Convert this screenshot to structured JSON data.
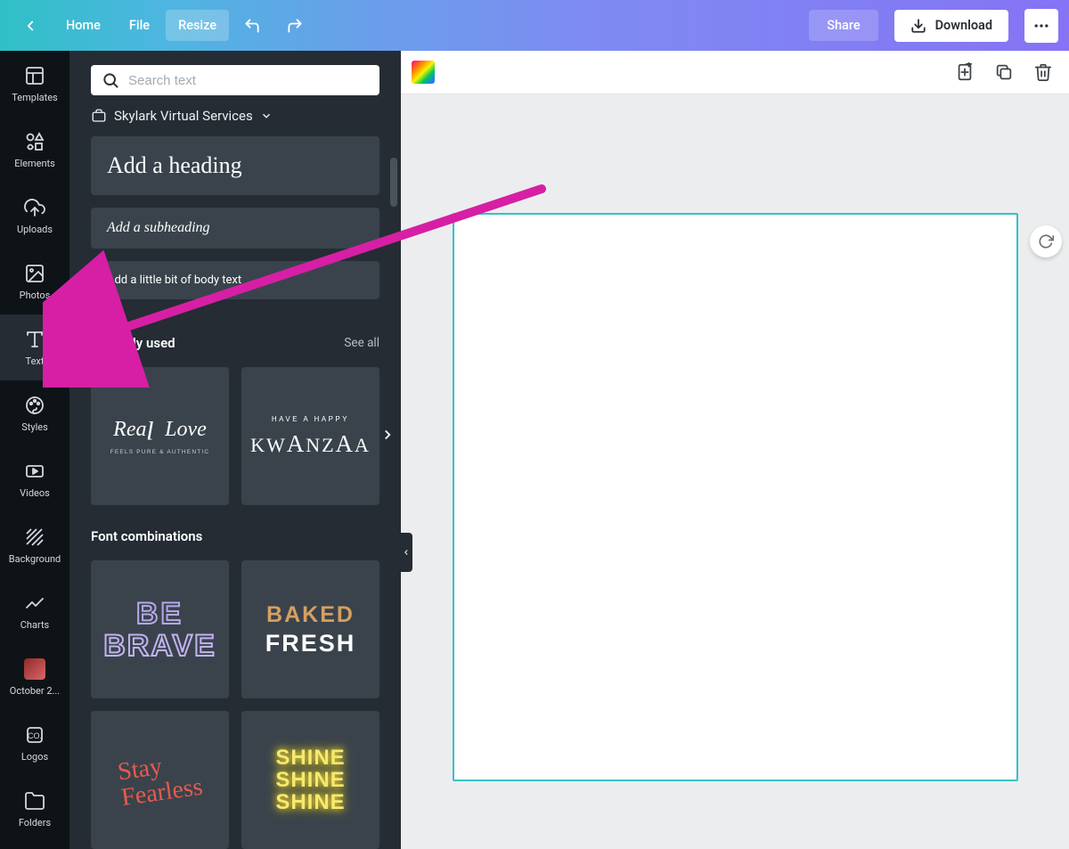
{
  "header": {
    "home": "Home",
    "file": "File",
    "resize": "Resize",
    "share": "Share",
    "download": "Download"
  },
  "sidebar": {
    "items": [
      {
        "label": "Templates"
      },
      {
        "label": "Elements"
      },
      {
        "label": "Uploads"
      },
      {
        "label": "Photos"
      },
      {
        "label": "Text"
      },
      {
        "label": "Styles"
      },
      {
        "label": "Videos"
      },
      {
        "label": "Background"
      },
      {
        "label": "Charts"
      },
      {
        "label": "October 2..."
      },
      {
        "label": "Logos"
      },
      {
        "label": "Folders"
      }
    ]
  },
  "panel": {
    "search_placeholder": "Search text",
    "brand_account": "Skylark Virtual Services",
    "add_heading": "Add a heading",
    "add_subheading": "Add a subheading",
    "add_body": "Add a little bit of body text",
    "recently_used_title": "Recently used",
    "see_all": "See all",
    "font_combinations_title": "Font combinations",
    "recent": [
      {
        "line1": "Real Love",
        "line2": "FEELS PURE & AUTHENTIC"
      },
      {
        "line1": "HAVE A HAPPY",
        "line2": "KWANZAA"
      }
    ],
    "combos": [
      {
        "line1": "BE",
        "line2": "BRAVE"
      },
      {
        "line1": "BAKED",
        "line2": "FRESH"
      },
      {
        "line1": "Stay",
        "line2": "Fearless"
      },
      {
        "line1": "SHINE",
        "line2": "SHINE",
        "line3": "SHINE"
      }
    ]
  },
  "annotation": {
    "arrow_color": "#d61fa5"
  }
}
